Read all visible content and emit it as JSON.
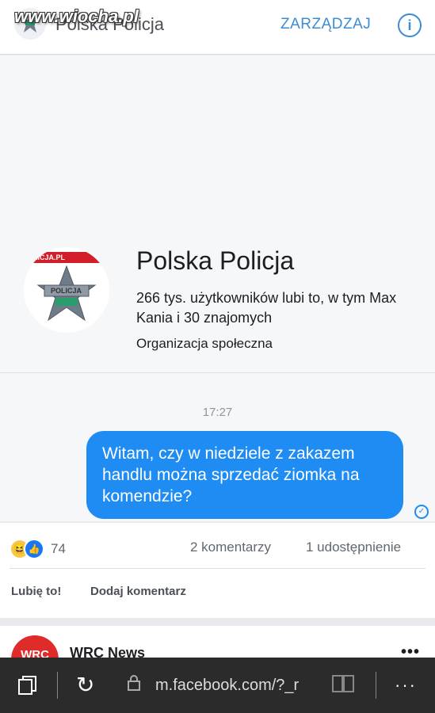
{
  "header": {
    "watermark": "www.wiocha.pl",
    "title": "Polska Policja",
    "manage_label": "ZARZĄDZAJ",
    "info_icon": "i"
  },
  "page_card": {
    "avatar_banner": "LICJA.PL",
    "avatar_badge_text": "POLICJA",
    "name": "Polska Policja",
    "likes_text": "266 tys. użytkowników lubi to, w tym Max Kania i 30 znajomych",
    "category": "Organizacja społeczna"
  },
  "chat": {
    "time": "17:27",
    "message": "Witam, czy w niedziele z zakazem handlu można sprzedać ziomka na komendzie?"
  },
  "stats": {
    "reaction_count": "74",
    "comments": "2 komentarzy",
    "shares": "1 udostępnienie",
    "like_label": "Lubię to!",
    "comment_label": "Dodaj komentarz"
  },
  "next_post": {
    "logo_text": "WRC",
    "name": "WRC News",
    "more": "•••"
  },
  "browser": {
    "url": "m.facebook.com/?_r",
    "more": "···"
  },
  "colors": {
    "accent": "#3b8cd5",
    "bubble": "#1e8cf2",
    "browser_bar": "#2b2b2b"
  }
}
